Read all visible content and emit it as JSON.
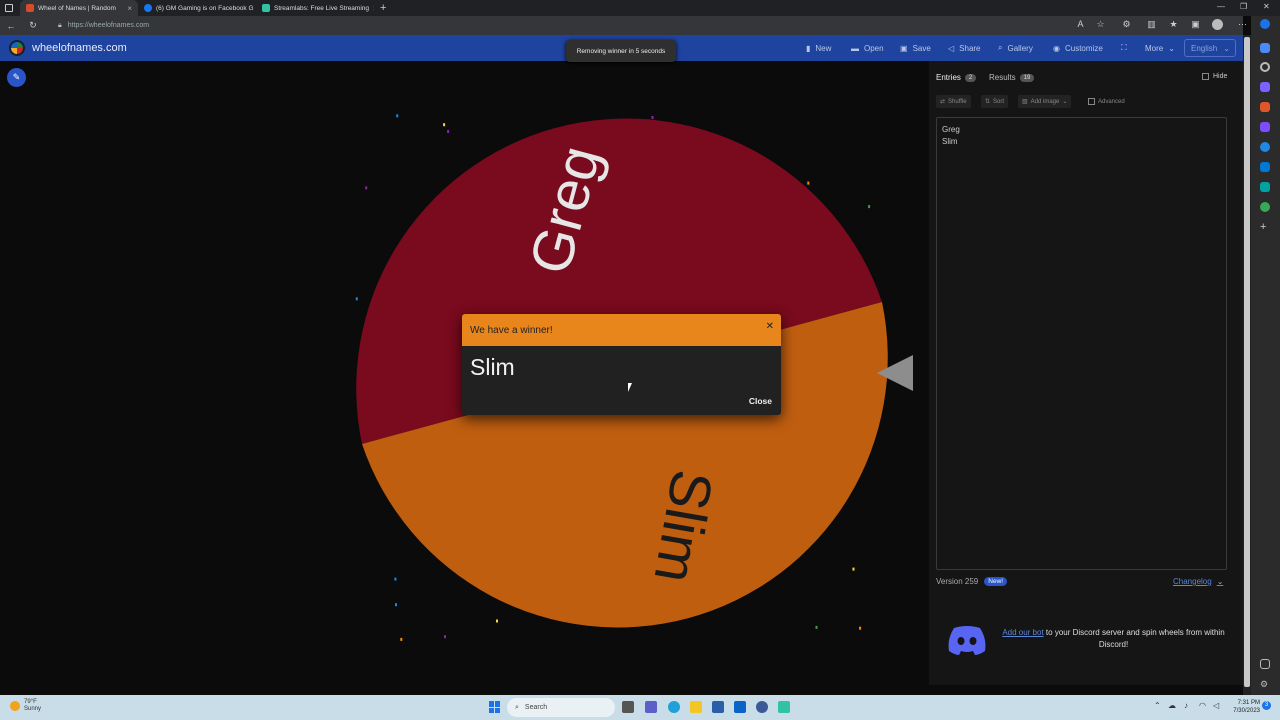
{
  "browser": {
    "tabs": [
      {
        "label": "Wheel of Names | Random",
        "icon_color": "#d94a2b",
        "active": true
      },
      {
        "label": "(6) GM Gaming is on Facebook G",
        "icon_color": "#1877f2",
        "active": false
      },
      {
        "label": "Streamlabs: Free Live Streaming",
        "icon_color": "#31c3a2",
        "active": false
      }
    ],
    "new_tab": "+",
    "url": "https://wheelofnames.com"
  },
  "site": {
    "name": "wheelofnames.com",
    "nav": [
      "New",
      "Open",
      "Save",
      "Share",
      "Gallery",
      "Customize",
      "More"
    ],
    "language": "English"
  },
  "toast": "Removing winner in 5 seconds",
  "wheel": {
    "segments": [
      {
        "label": "Greg",
        "color": "#7a0a1d"
      },
      {
        "label": "Slim",
        "color": "#c05e10"
      }
    ]
  },
  "modal": {
    "title": "We have a winner!",
    "winner": "Slim",
    "close_label": "Close",
    "header_color": "#e8861c"
  },
  "panel": {
    "tabs": [
      {
        "label": "Entries",
        "count": "2"
      },
      {
        "label": "Results",
        "count": "19"
      }
    ],
    "hide_label": "Hide",
    "tools": [
      "Shuffle",
      "Sort",
      "Add image",
      "Advanced"
    ],
    "entries": [
      "Greg",
      "Slim"
    ],
    "version": "Version 259",
    "new_badge": "New!",
    "changelog": "Changelog",
    "discord_link": "Add our bot",
    "discord_text": "to your Discord server and spin wheels from within Discord!"
  },
  "taskbar": {
    "weather_temp": "79°F",
    "weather_desc": "Sunny",
    "search": "Search",
    "time": "7:31 PM",
    "date": "7/30/2023"
  }
}
